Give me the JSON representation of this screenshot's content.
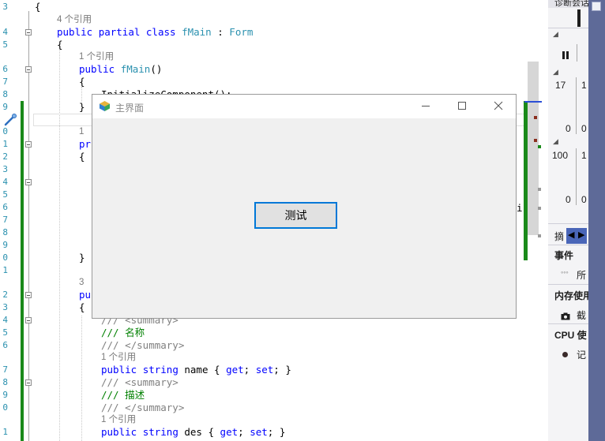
{
  "code_lines": [
    {
      "ln": "3",
      "text": "{"
    },
    {
      "ln": "",
      "text": "4 个引用"
    },
    {
      "ln": "4",
      "text": "public partial class fMain : Form"
    },
    {
      "ln": "5",
      "text": "{"
    },
    {
      "ln": "",
      "text": "1 个引用"
    },
    {
      "ln": "6",
      "text": "public fMain()"
    },
    {
      "ln": "7",
      "text": "{"
    },
    {
      "ln": "8",
      "text": "InitializeComponent();"
    },
    {
      "ln": "9",
      "text": "}"
    },
    {
      "ln": "0",
      "text": "1"
    },
    {
      "ln": "1",
      "text": "pri"
    },
    {
      "ln": "2",
      "text": "{"
    },
    {
      "ln": "3",
      "text": ""
    },
    {
      "ln": "4",
      "text": ""
    },
    {
      "ln": "5",
      "text": ""
    },
    {
      "ln": "6",
      "text": ""
    },
    {
      "ln": "7",
      "text": "i."
    },
    {
      "ln": "8",
      "text": ""
    },
    {
      "ln": "9",
      "text": ""
    },
    {
      "ln": "0",
      "text": "}"
    },
    {
      "ln": "1",
      "text": ""
    },
    {
      "ln": "",
      "text": "3"
    },
    {
      "ln": "2",
      "text": "pub"
    },
    {
      "ln": "3",
      "text": "{"
    },
    {
      "ln": "4",
      "text": "/// <summary>"
    },
    {
      "ln": "5",
      "text": "/// 名称"
    },
    {
      "ln": "6",
      "text": "/// </summary>"
    },
    {
      "ln": "",
      "text": "1 个引用"
    },
    {
      "ln": "7",
      "text": "public string name { get; set; }"
    },
    {
      "ln": "8",
      "text": "/// <summary>"
    },
    {
      "ln": "9",
      "text": "/// 描述"
    },
    {
      "ln": "0",
      "text": "/// </summary>"
    },
    {
      "ln": "",
      "text": "1 个引用"
    },
    {
      "ln": "1",
      "text": "public string des { get; set; }"
    }
  ],
  "dialog": {
    "title": "主界面",
    "minimize_glyph": "—",
    "close_glyph": "✕",
    "button_label": "测试"
  },
  "right_panel": {
    "header": "诊断会话",
    "values": [
      "17",
      "1",
      "0",
      "0",
      "100",
      "1",
      "0",
      "0"
    ],
    "summary_tab": "摘",
    "events_label": "事件",
    "events_item": "所",
    "memory_label": "内存使用",
    "memory_item": "截",
    "cpu_label": "CPU 使",
    "cpu_item": "记"
  },
  "colors": {
    "keyword": "#0000ff",
    "type": "#2b91af",
    "comment": "#008000",
    "accent": "#0078d7",
    "change_bar": "#1a8a1a",
    "side_strip": "#5e6a98"
  }
}
